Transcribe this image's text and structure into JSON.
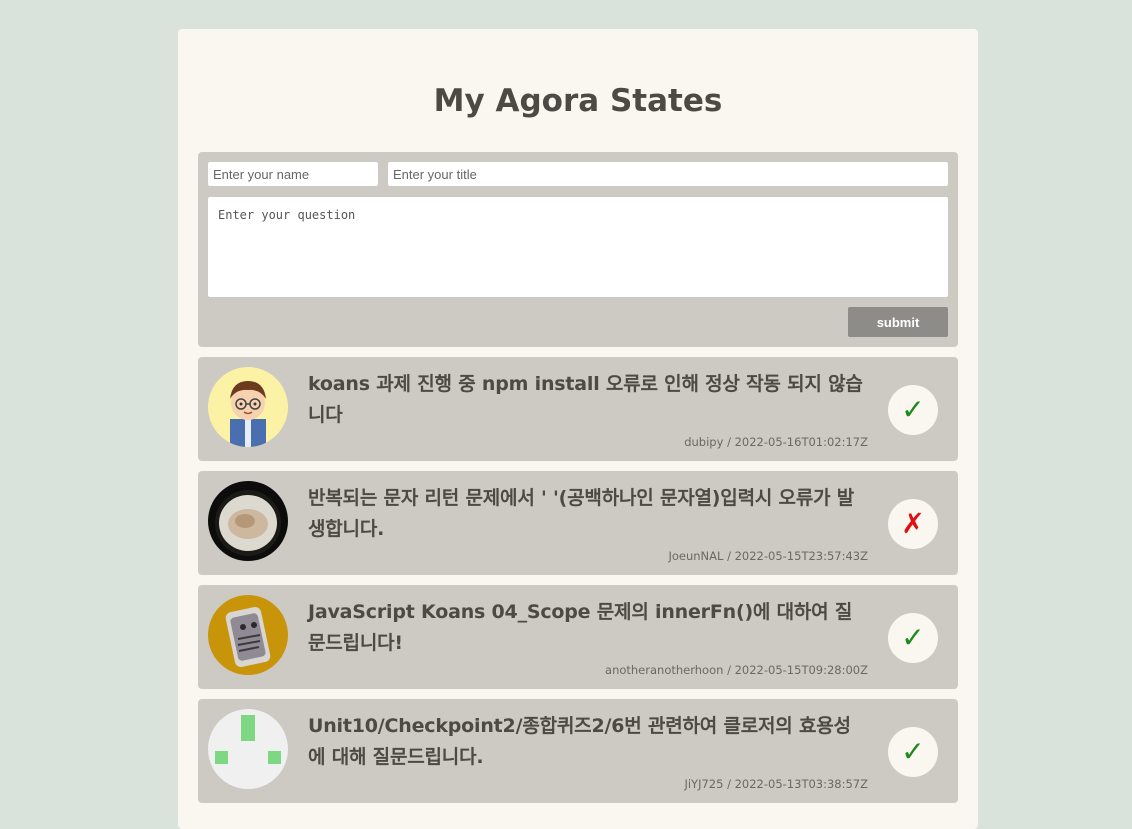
{
  "page": {
    "title": "My Agora States"
  },
  "form": {
    "name_placeholder": "Enter your name",
    "title_placeholder": "Enter your title",
    "question_placeholder": "Enter your question",
    "submit_label": "submit"
  },
  "discussions": [
    {
      "title": "koans 과제 진행 중 npm install 오류로 인해 정상 작동 되지 않습니다",
      "author": "dubipy",
      "separator": " / ",
      "created_at": "2022-05-16T01:02:17Z",
      "answered_mark": "✓",
      "answered": true
    },
    {
      "title": "반복되는 문자 리턴 문제에서 ' '(공백하나인 문자열)입력시 오류가 발생합니다.",
      "author": "JoeunNAL",
      "separator": " / ",
      "created_at": "2022-05-15T23:57:43Z",
      "answered_mark": "✗",
      "answered": false
    },
    {
      "title": "JavaScript Koans 04_Scope 문제의 innerFn()에 대하여 질문드립니다!",
      "author": "anotheranotherhoon",
      "separator": " / ",
      "created_at": "2022-05-15T09:28:00Z",
      "answered_mark": "✓",
      "answered": true
    },
    {
      "title": "Unit10/Checkpoint2/종합퀴즈2/6번 관련하여 클로저의 효용성에 대해 질문드립니다.",
      "author": "JiYJ725",
      "separator": " / ",
      "created_at": "2022-05-13T03:38:57Z",
      "answered_mark": "✓",
      "answered": true
    }
  ],
  "colors": {
    "background": "#d9e3dc",
    "panel": "#faf6f0",
    "card": "#cdcac3",
    "button": "#8e8c89",
    "check": "#1a8a1a",
    "cross": "#e01010"
  }
}
